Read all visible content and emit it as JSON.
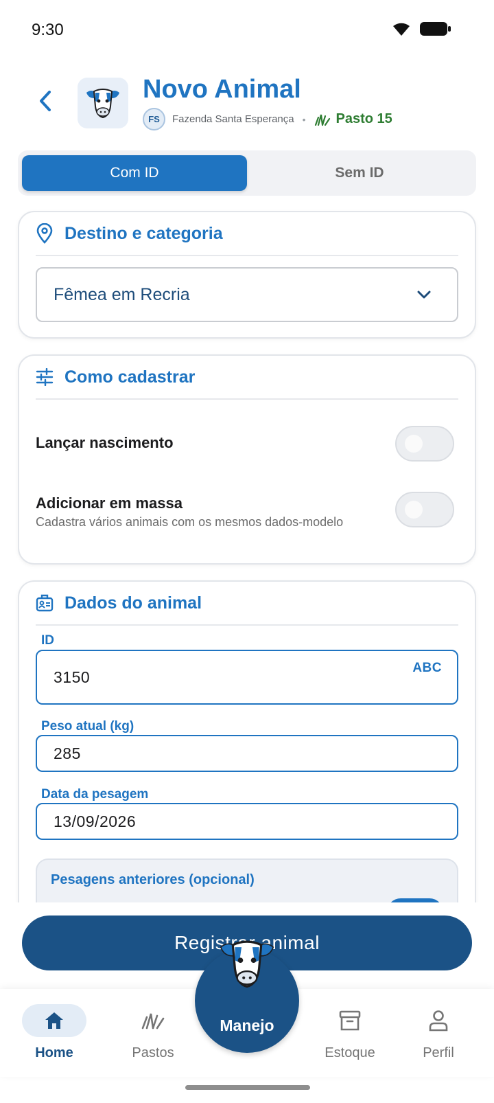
{
  "status_bar": {
    "time": "9:30"
  },
  "header": {
    "title": "Novo Animal",
    "farm_initials": "FS",
    "farm_name": "Fazenda Santa Esperança",
    "separator": "•",
    "pasture": "Pasto 15"
  },
  "segments": {
    "with_id": "Com ID",
    "without_id": "Sem ID",
    "active": "with_id"
  },
  "destination_card": {
    "title": "Destino e categoria",
    "category_value": "Fêmea em Recria"
  },
  "how_card": {
    "title": "Como cadastrar",
    "birth_toggle": {
      "label": "Lançar nascimento",
      "on": false
    },
    "bulk_toggle": {
      "label": "Adicionar em massa",
      "description": "Cadastra vários animais com os mesmos dados-modelo",
      "on": false
    }
  },
  "data_card": {
    "title": "Dados do animal",
    "id_label": "ID",
    "id_value": "3150",
    "id_mode": "ABC",
    "weight_label": "Peso atual (kg)",
    "weight_value": "285",
    "date_label": "Data da pesagem",
    "date_value": "13/09/2026",
    "previous_title": "Pesagens anteriores (opcional)"
  },
  "register_button": "Registrar animal",
  "bottom_nav": {
    "home": "Home",
    "pastures": "Pastos",
    "center": "Manejo",
    "stock": "Estoque",
    "profile": "Perfil",
    "active": "home"
  },
  "colors": {
    "primary": "#1f74c1",
    "dark_primary": "#1b5286",
    "pasture_green": "#2e7d32"
  }
}
